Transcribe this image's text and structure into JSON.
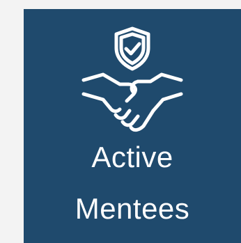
{
  "tile": {
    "line1": "Active",
    "line2": "Mentees",
    "icon": "shield-handshake-icon",
    "background": "#1f4a6d",
    "foreground": "#ffffff",
    "page_background": "#f3f3f3"
  }
}
